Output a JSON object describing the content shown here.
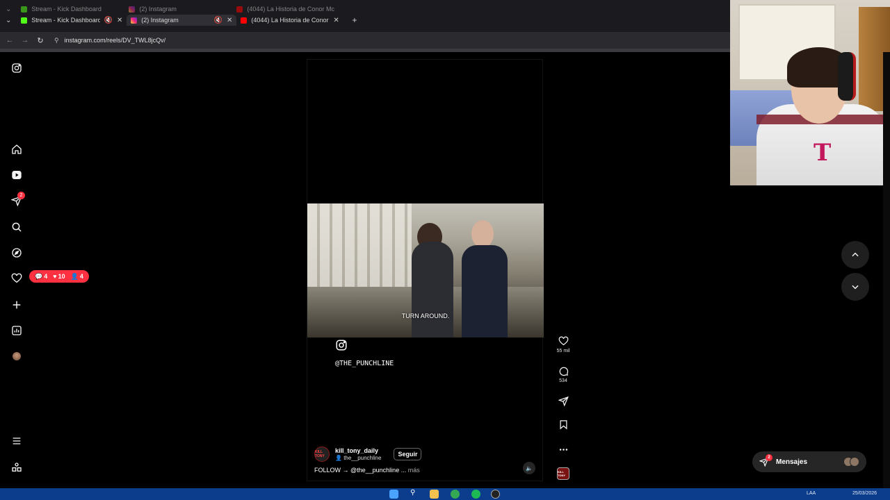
{
  "browser": {
    "tabs": [
      {
        "title": "Stream - Kick Dashboard",
        "favicon": "kick-icon"
      },
      {
        "title": "(2) Instagram",
        "favicon": "instagram-icon",
        "active": true
      },
      {
        "title": "(4044) La Historia de Conor Mc",
        "favicon": "youtube-icon"
      }
    ],
    "url": "instagram.com/reels/DV_TWL8jcQv/"
  },
  "sidebar": {
    "direct_badge": "2",
    "notifications": {
      "comments": "4",
      "likes": "10",
      "follows": "4"
    }
  },
  "reel": {
    "subtitle": "TURN AROUND.",
    "overlay_handle": "@THE_PUNCHLINE",
    "author": "kill_tony_daily",
    "collab": "the__punchline",
    "follow_label": "Seguir",
    "caption": "FOLLOW → @the__punchline ...",
    "caption_more": "más",
    "author_avatar_text": "KILL TONY",
    "likes": "55 mil",
    "comments": "534"
  },
  "messages": {
    "label": "Mensajes",
    "badge": "2"
  },
  "taskbar": {
    "lang": "LAA",
    "date": "25/03/2026"
  },
  "colors": {
    "accent_red": "#ff3040",
    "bg": "#000000",
    "panel": "#262626"
  }
}
